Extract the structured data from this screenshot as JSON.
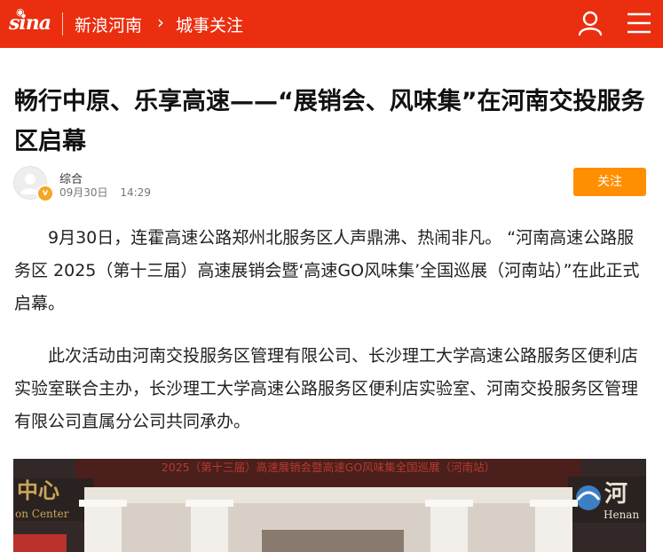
{
  "header": {
    "logo_text": "sina",
    "channel": "新浪河南",
    "section": "城事关注"
  },
  "article": {
    "title": "畅行中原、乐享高速——“展销会、风味集”在河南交投服务区启幕",
    "author": "综合",
    "date": "09月30日",
    "time": "14:29",
    "follow_label": "关注",
    "paragraphs": [
      "9月30日，连霍高速公路郑州北服务区人声鼎沸、热闹非凡。 “河南高速公路服务区 2025（第十三届）高速展销会暨‘高速GO风味集’全国巡展（河南站）”在此正式启幕。",
      "此次活动由河南交投服务区管理有限公司、长沙理工大学高速公路服务区便利店实验室联合主办，长沙理工大学高速公路服务区便利店实验室、河南交投服务区管理有限公司直属分公司共同承办。"
    ]
  },
  "photo": {
    "banner_text": "2025（第十三届）高速展销会暨高速GO风味集全国巡展（河南站）",
    "left_sign": "中心",
    "left_sign_en": "on Center",
    "right_sign": "河",
    "right_sign_en": "Henan"
  },
  "colors": {
    "topbar": "#ea2e0f",
    "follow_button": "#ff8f00",
    "badge": "#f5a623"
  }
}
